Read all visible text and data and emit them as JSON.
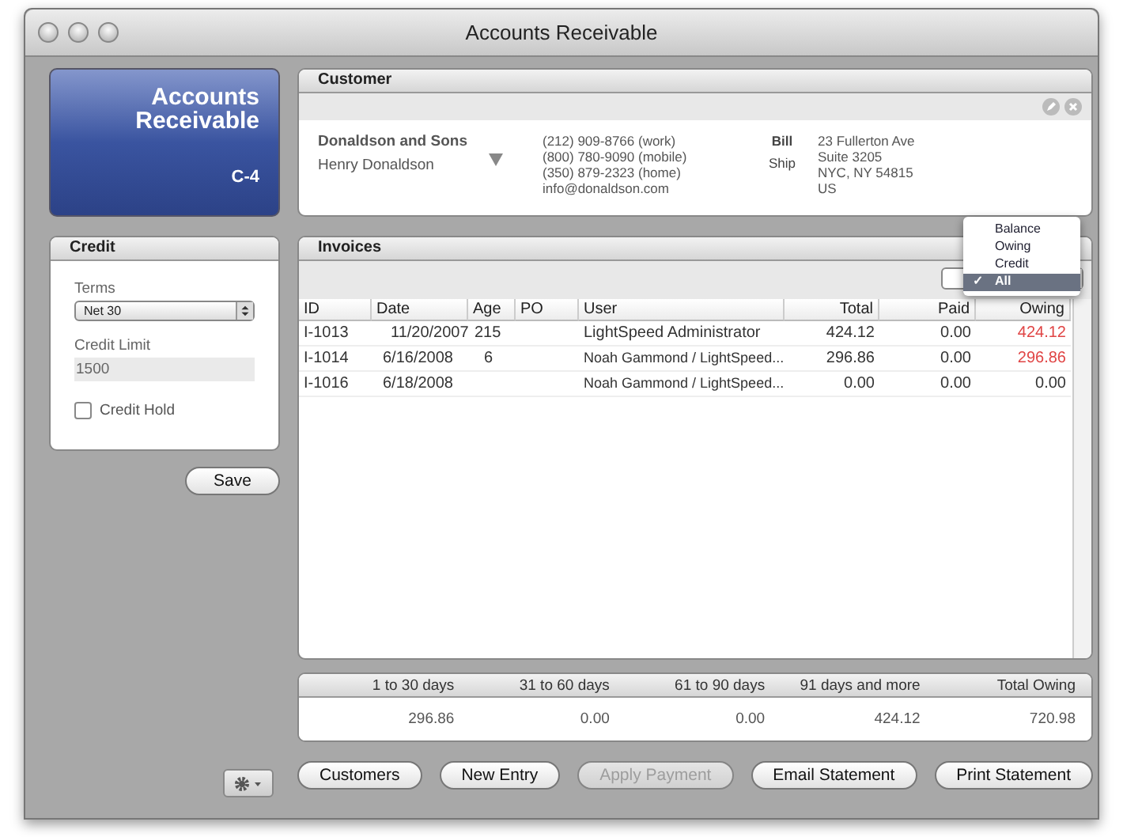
{
  "window": {
    "title": "Accounts Receivable"
  },
  "badge": {
    "title": "Accounts Receivable",
    "code": "C-4"
  },
  "customer": {
    "header": "Customer",
    "company": "Donaldson and Sons",
    "contact": "Henry Donaldson",
    "phones": [
      "(212) 909-8766 (work)",
      "(800) 780-9090 (mobile)",
      "(350) 879-2323 (home)",
      "info@donaldson.com"
    ],
    "address_types": [
      {
        "label": "Bill",
        "selected": true
      },
      {
        "label": "Ship",
        "selected": false
      }
    ],
    "address": [
      "23 Fullerton Ave",
      "Suite 3205",
      "NYC, NY 54815",
      "US"
    ]
  },
  "credit": {
    "header": "Credit",
    "terms_label": "Terms",
    "terms": "Net 30",
    "limit_label": "Credit Limit",
    "limit": "1500",
    "hold": {
      "label": "Credit Hold",
      "checked": false
    }
  },
  "save_button": "Save",
  "invoices": {
    "header": "Invoices",
    "filter_menu": [
      {
        "label": "Balance",
        "selected": false
      },
      {
        "label": "Owing",
        "selected": false
      },
      {
        "label": "Credit",
        "selected": false
      },
      {
        "label": "All",
        "selected": true
      }
    ],
    "check_mark": "✓",
    "columns": [
      "ID",
      "Date",
      "Age",
      "PO",
      "User",
      "Total",
      "Paid",
      "Owing"
    ],
    "rows": [
      {
        "cells": [
          "I-1013",
          "11/20/2007",
          "215",
          "",
          "LightSpeed Administrator",
          "424.12",
          "0.00",
          "424.12"
        ],
        "overdue": true
      },
      {
        "cells": [
          "I-1014",
          "6/16/2008",
          "6",
          "",
          "Noah Gammond / LightSpeed...",
          "296.86",
          "0.00",
          "296.86"
        ],
        "overdue": true
      },
      {
        "cells": [
          "I-1016",
          "6/18/2008",
          "",
          "",
          "Noah Gammond / LightSpeed...",
          "0.00",
          "0.00",
          "0.00"
        ],
        "overdue": false
      }
    ]
  },
  "aging": {
    "columns": [
      "1 to 30 days",
      "31 to 60 days",
      "61 to 90 days",
      "91 days and more",
      "Total Owing"
    ],
    "values": [
      "296.86",
      "0.00",
      "0.00",
      "424.12",
      "720.98"
    ]
  },
  "buttons": [
    {
      "label": "Customers",
      "disabled": false
    },
    {
      "label": "New Entry",
      "disabled": false
    },
    {
      "label": "Apply Payment",
      "disabled": true
    },
    {
      "label": "Email Statement",
      "disabled": false
    },
    {
      "label": "Print Statement",
      "disabled": false
    }
  ]
}
